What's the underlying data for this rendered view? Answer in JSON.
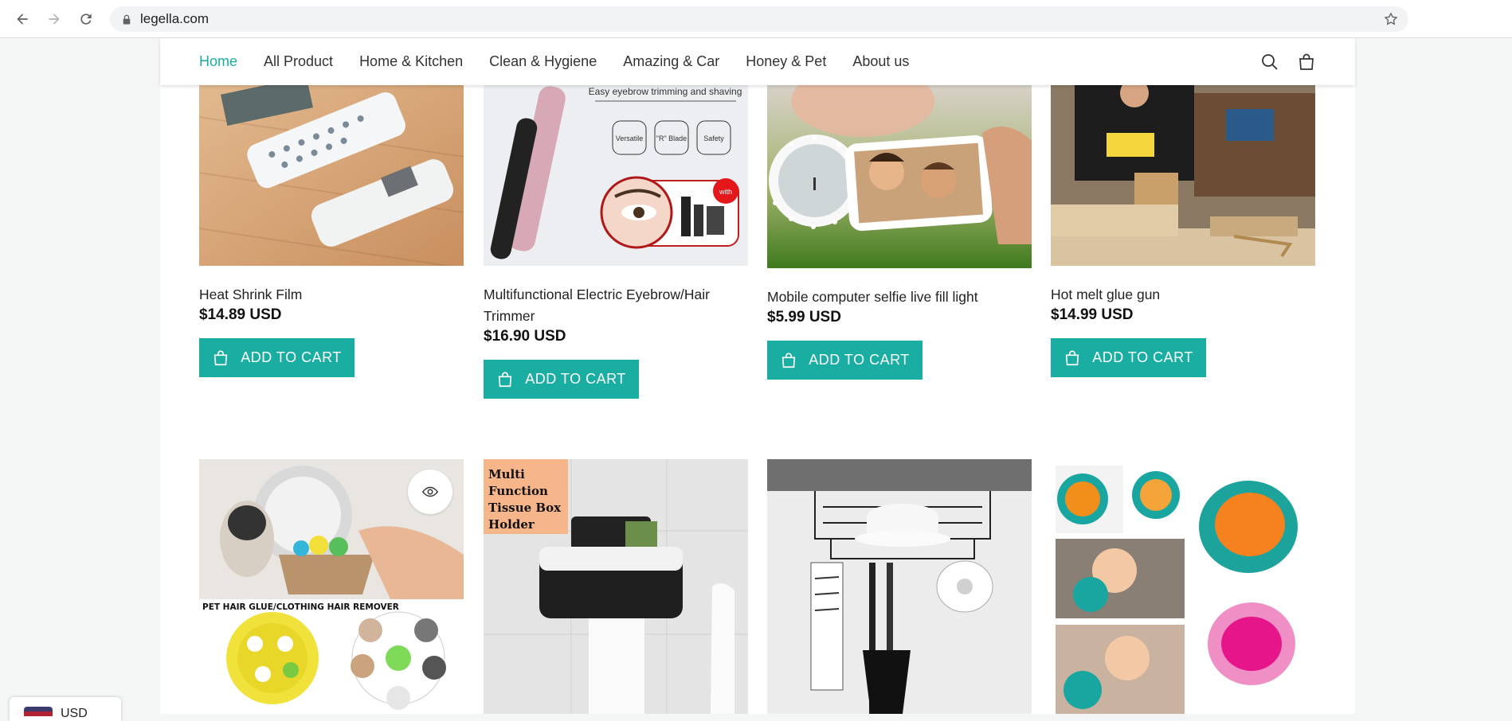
{
  "browser": {
    "url": "legella.com"
  },
  "nav": {
    "items": [
      {
        "label": "Home",
        "active": true
      },
      {
        "label": "All Product"
      },
      {
        "label": "Home & Kitchen"
      },
      {
        "label": "Clean & Hygiene"
      },
      {
        "label": "Amazing & Car"
      },
      {
        "label": "Honey & Pet"
      },
      {
        "label": "About us"
      }
    ],
    "accent_color": "#1aaea3"
  },
  "products_row1": [
    {
      "title": "Heat Shrink Film",
      "price": "$14.89 USD",
      "button": "ADD TO CART"
    },
    {
      "title": "Multifunctional Electric Eyebrow/Hair Trimmer",
      "price": "$16.90 USD",
      "button": "ADD TO CART",
      "image_text": {
        "banner": "Easy eyebrow trimming and shaving",
        "f1": "Versatile",
        "f2": "\"R\" Blade",
        "f3": "Safety",
        "badge": "with"
      }
    },
    {
      "title": "Mobile computer selfie live fill light",
      "price": "$5.99 USD",
      "button": "ADD TO CART"
    },
    {
      "title": "Hot melt glue gun",
      "price": "$14.99 USD",
      "button": "ADD TO CART"
    }
  ],
  "products_row2": [
    {
      "image_text": "PET HAIR GLUE/CLOTHING HAIR REMOVER"
    },
    {
      "image_text": "Multi Function Tissue Box Holder"
    },
    {},
    {}
  ],
  "currency": {
    "code": "USD"
  }
}
